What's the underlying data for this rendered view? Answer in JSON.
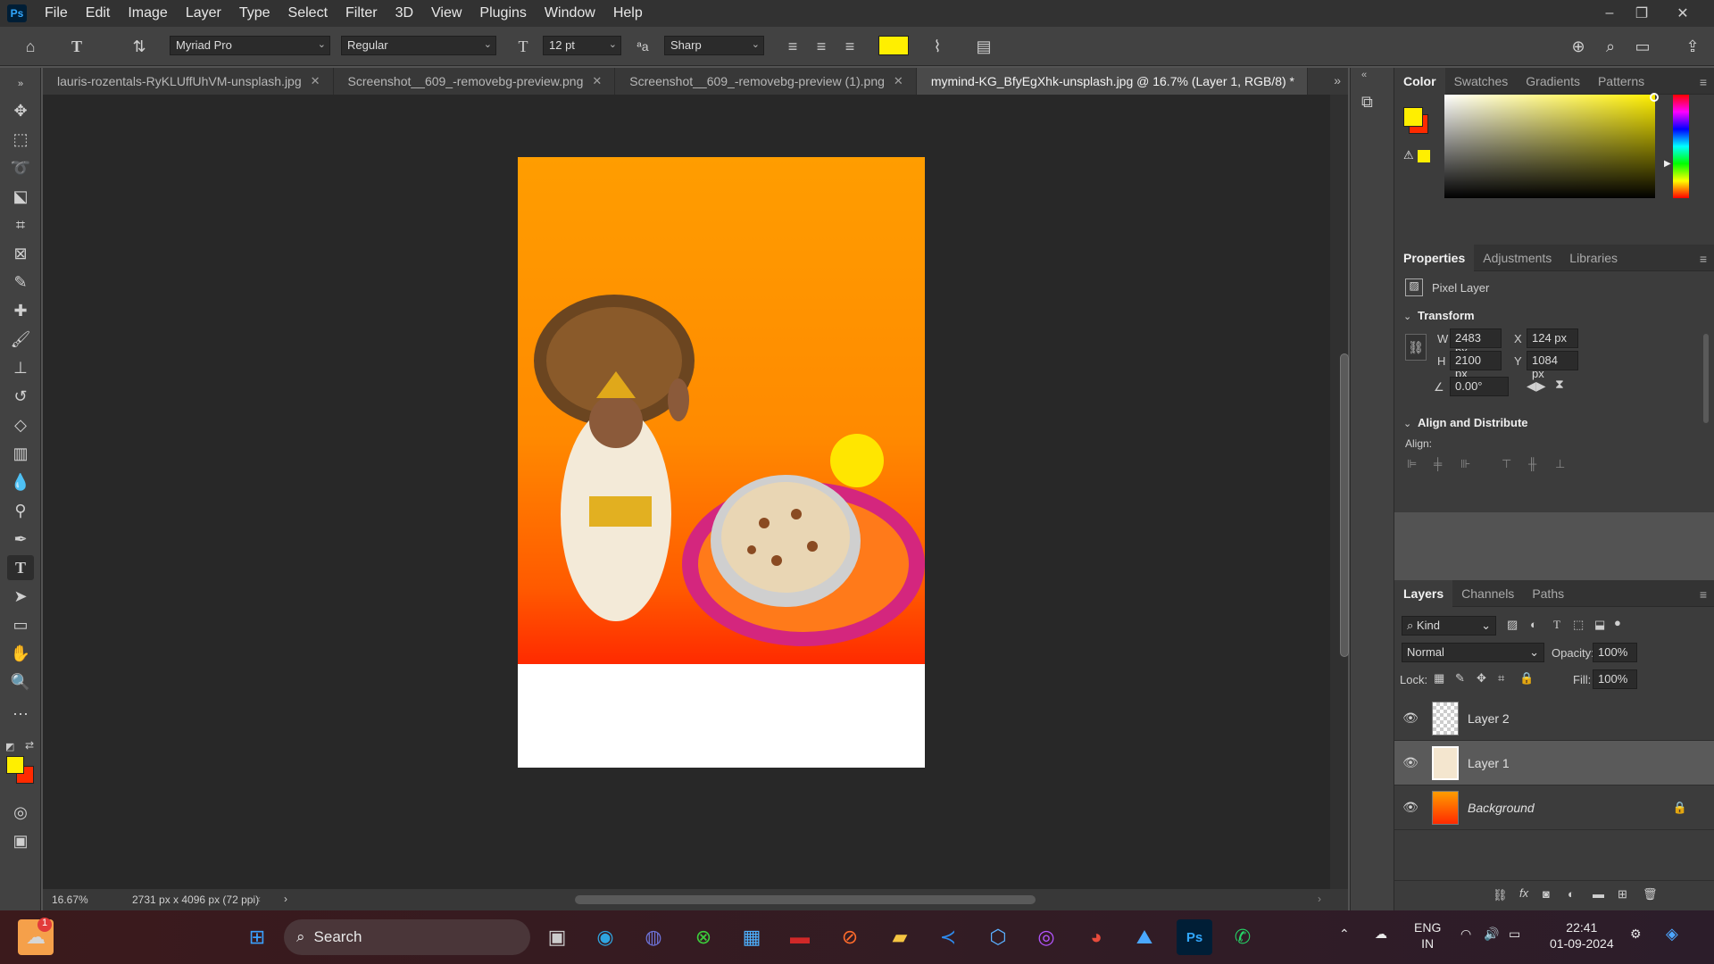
{
  "menubar": {
    "logo": "Ps",
    "items": [
      "File",
      "Edit",
      "Image",
      "Layer",
      "Type",
      "Select",
      "Filter",
      "3D",
      "View",
      "Plugins",
      "Window",
      "Help"
    ]
  },
  "options": {
    "font_family": "Myriad Pro",
    "font_style": "Regular",
    "font_size": "12 pt",
    "antialias": "Sharp",
    "color_swatch": "#ffef00"
  },
  "tabs": [
    {
      "label": "lauris-rozentals-RyKLUffUhVM-unsplash.jpg"
    },
    {
      "label": "Screenshot__609_-removebg-preview.png"
    },
    {
      "label": "Screenshot__609_-removebg-preview (1).png"
    },
    {
      "label": "mymind-KG_BfyEgXhk-unsplash.jpg @ 16.7% (Layer 1, RGB/8) *"
    }
  ],
  "status": {
    "zoom": "16.67%",
    "doc_info": "2731 px x 4096 px (72 ppi)"
  },
  "color_panel": {
    "tabs": [
      "Color",
      "Swatches",
      "Gradients",
      "Patterns"
    ],
    "fg_color": "#ffef00",
    "bg_color": "#ff2a00"
  },
  "properties": {
    "tabs": [
      "Properties",
      "Adjustments",
      "Libraries"
    ],
    "layer_type": "Pixel Layer",
    "transform_title": "Transform",
    "w_label": "W",
    "w": "2483 px",
    "h_label": "H",
    "h": "2100 px",
    "x_label": "X",
    "x": "124 px",
    "y_label": "Y",
    "y": "1084 px",
    "angle": "0.00°",
    "align_title": "Align and Distribute",
    "align_label": "Align:"
  },
  "layers": {
    "tabs": [
      "Layers",
      "Channels",
      "Paths"
    ],
    "filter": "Kind",
    "blend": "Normal",
    "opacity_label": "Opacity:",
    "opacity": "100%",
    "lock_label": "Lock:",
    "fill_label": "Fill:",
    "fill": "100%",
    "items": [
      {
        "name": "Layer 2"
      },
      {
        "name": "Layer 1"
      },
      {
        "name": "Background"
      }
    ]
  },
  "taskbar": {
    "search": "Search",
    "lang_top": "ENG",
    "lang_bottom": "IN",
    "time": "22:41",
    "date": "01-09-2024",
    "weather_badge": "1"
  }
}
